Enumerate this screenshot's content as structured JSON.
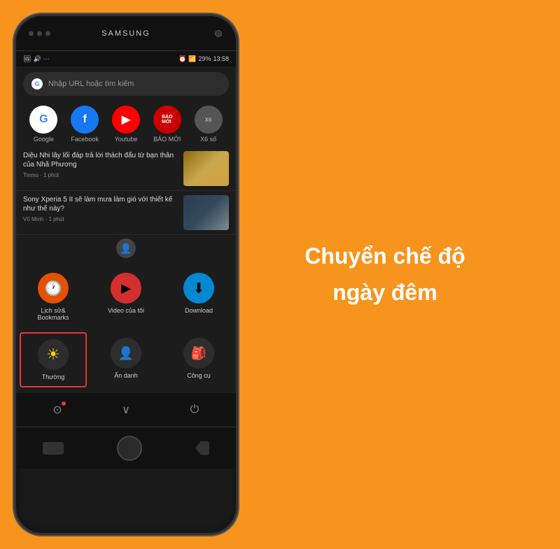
{
  "background_color": "#F7941D",
  "phone": {
    "brand": "SAMSUNG",
    "status_bar": {
      "left_icons": [
        "📷",
        "🔊",
        "···"
      ],
      "time": "13:58",
      "battery": "29%",
      "signal": "WiFi"
    },
    "browser": {
      "url_placeholder": "Nhập URL hoặc tìm kiếm",
      "quick_links": [
        {
          "label": "Google",
          "icon": "G",
          "class": "ql-google"
        },
        {
          "label": "Facebook",
          "icon": "f",
          "class": "ql-facebook"
        },
        {
          "label": "Youtube",
          "icon": "▶",
          "class": "ql-youtube"
        },
        {
          "label": "BÁO MỚI",
          "icon": "BM",
          "class": "ql-baomoi"
        },
        {
          "label": "X6 số",
          "icon": "X6",
          "class": "ql-x6"
        }
      ],
      "news": [
        {
          "title": "Diệu Nhi lây lối đáp trả lời thách đấu từ bạn thân của Nhã Phương",
          "meta": "Tinmo · 1 phút"
        },
        {
          "title": "Sony Xperia 5 II sẽ làm mưa làm gió với thiết kế như thế này?",
          "meta": "Vũ Minh · 1 phút"
        }
      ],
      "menu_items": [
        {
          "label": "Lịch sử&\nBookmarks",
          "icon": "🕐",
          "icon_class": "menu-icon-history",
          "highlighted": false
        },
        {
          "label": "Video của tôi",
          "icon": "▶",
          "icon_class": "menu-icon-video",
          "highlighted": false
        },
        {
          "label": "Download",
          "icon": "⬇",
          "icon_class": "menu-icon-download",
          "highlighted": false
        },
        {
          "label": "Thường",
          "icon": "☀",
          "icon_class": "menu-icon-normal",
          "highlighted": true
        },
        {
          "label": "Ẩn danh",
          "icon": "👤",
          "icon_class": "menu-icon-incognito",
          "highlighted": false
        },
        {
          "label": "Công cụ",
          "icon": "🎒",
          "icon_class": "menu-icon-tools",
          "highlighted": false
        }
      ]
    }
  },
  "heading": {
    "line1": "Chuyển chế độ",
    "line2": "ngày đêm"
  }
}
